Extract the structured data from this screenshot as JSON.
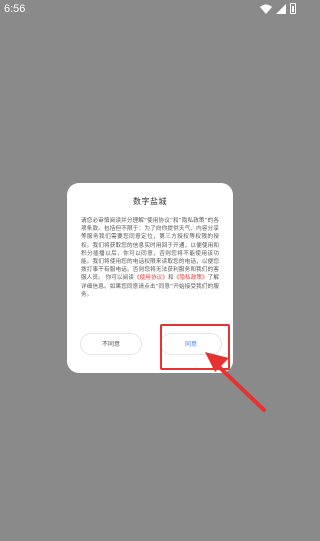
{
  "status_bar": {
    "time": "6:56"
  },
  "dialog": {
    "title": "数字盐城",
    "body_part1": "请您必审慎阅读并分理解“使用协议”和“隐私政策”的各项条款。包括但不限于：为了向你提供天气、内容分享等服务我们需要您同意定位，第三方授权等权限的授权。我们将获取您的信息实时用回于开通，以便使用和积分插播以后，你可以同意，否则您将不能使用该功能。我们将使用您的电话权限来读取您的电话，以便您拨打事干有服电话。否则您将无法获利服务和我们的客服人员。",
    "body_part2": "你可以阅读",
    "link1": "《使用协议》",
    "body_part3": "和",
    "link2": "《隐私政策》",
    "body_part4": "了解详细信息。如果您同意请点击“同意”开始接受我们的服务。",
    "disagree_label": "不同意",
    "agree_label": "同意"
  },
  "colors": {
    "overlay": "#8a8a8a",
    "highlight": "#e8322f",
    "link": "#e53935",
    "agree_text": "#4285f4"
  }
}
